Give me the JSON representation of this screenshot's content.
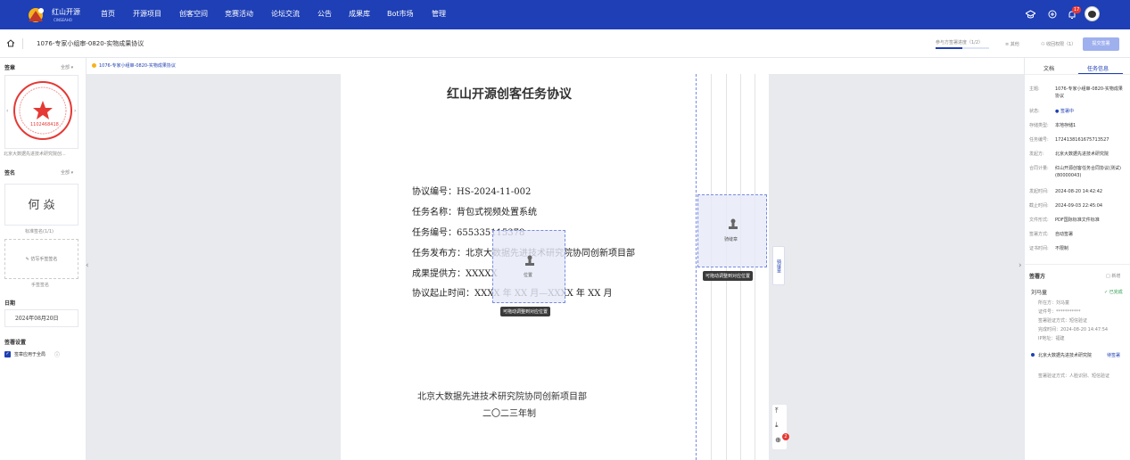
{
  "nav": {
    "logo_text": "红山开源",
    "logo_sub": "CINSEAHO",
    "items": [
      "首页",
      "开源项目",
      "创客空间",
      "竞赛活动",
      "论坛交流",
      "公告",
      "成果库",
      "Bot市场",
      "管理"
    ],
    "badge": "17"
  },
  "subbar": {
    "title": "1076-专家小组审-0820-实物成果协议",
    "progress": "参与方签署进度（1/2）",
    "btn_other": "其他",
    "btn_rights": "收回权限（1）",
    "btn_submit": "提交签署"
  },
  "left": {
    "seal_title": "签章",
    "seal_all": "全部 ▾",
    "seal_name": "北京大数据先进技术研究院创...",
    "seal_number": "1102468418",
    "sign_title": "签名",
    "sign_all": "全部 ▾",
    "sign_text": "何 焱",
    "sign_caption": "标准签名(1/1)",
    "hand_btn": "仿写手签签名",
    "hand_caption": "手签签名",
    "date_title": "日期",
    "date_value": "2024年08月20日",
    "settings_title": "签署设置",
    "checkbox_label": "签章应用于全局"
  },
  "notice": "1076-专家小组审-0820-实物成果协议",
  "doc": {
    "title": "红山开源创客任务协议",
    "lines": [
      "协议编号：HS-2024-11-002",
      "任务名称：背包式视频处置系统",
      "任务编号：655335115378",
      "任务发布方：北京大数据先进技术研究院协同创新项目部",
      "成果提供方：XXXXX",
      "协议起止时间：XXXX 年 XX 月—XXXX 年 XX 月"
    ],
    "footer1": "北京大数据先进技术研究院协同创新项目部",
    "footer2": "二〇二三年制"
  },
  "placeholders": {
    "pos_label": "位置",
    "tip": "可拖动调整到对应位置",
    "riding_label": "骑缝章",
    "side_btn": "骑缝章"
  },
  "tools": {
    "badge": "2"
  },
  "right": {
    "tab_doc": "文档",
    "tab_info": "任务信息",
    "fields": [
      [
        "主题:",
        "1076-专家小组审-0820-实物成果协议"
      ],
      [
        "状态:",
        "● 签署中"
      ],
      [
        "存储类型:",
        "本地存储1"
      ],
      [
        "任务编号:",
        "1724138161675713527"
      ],
      [
        "发起方:",
        "北京大数据先进技术研究院"
      ],
      [
        "合同计量:",
        "红山开源创客任务合同协议(测试)(80000043)"
      ],
      [
        "发起时间:",
        "2024-08-20 14:42:42"
      ],
      [
        "截止时间:",
        "2024-09-03 22:45:04"
      ],
      [
        "文件形式:",
        "PDF国际标准文件标准"
      ],
      [
        "签署方式:",
        "自动签署"
      ],
      [
        "证书时间:",
        "不限制"
      ]
    ],
    "signers_title": "签署方",
    "signers_more": "□ 新增",
    "signer1": "刘马童",
    "signer1_status": "✓ 已完成",
    "signer1_lines": [
      "所在方：刘马童",
      "证件号：***********",
      "签署验证方式：短信验证",
      "完成时间：2024-08-20 14:47:54",
      "IP地址：福建"
    ],
    "signer2": "北京大数据先进技术研究院",
    "signer2_status": "待签署",
    "signer2_line": "签署验证方式：人脸识别、短信验证"
  }
}
